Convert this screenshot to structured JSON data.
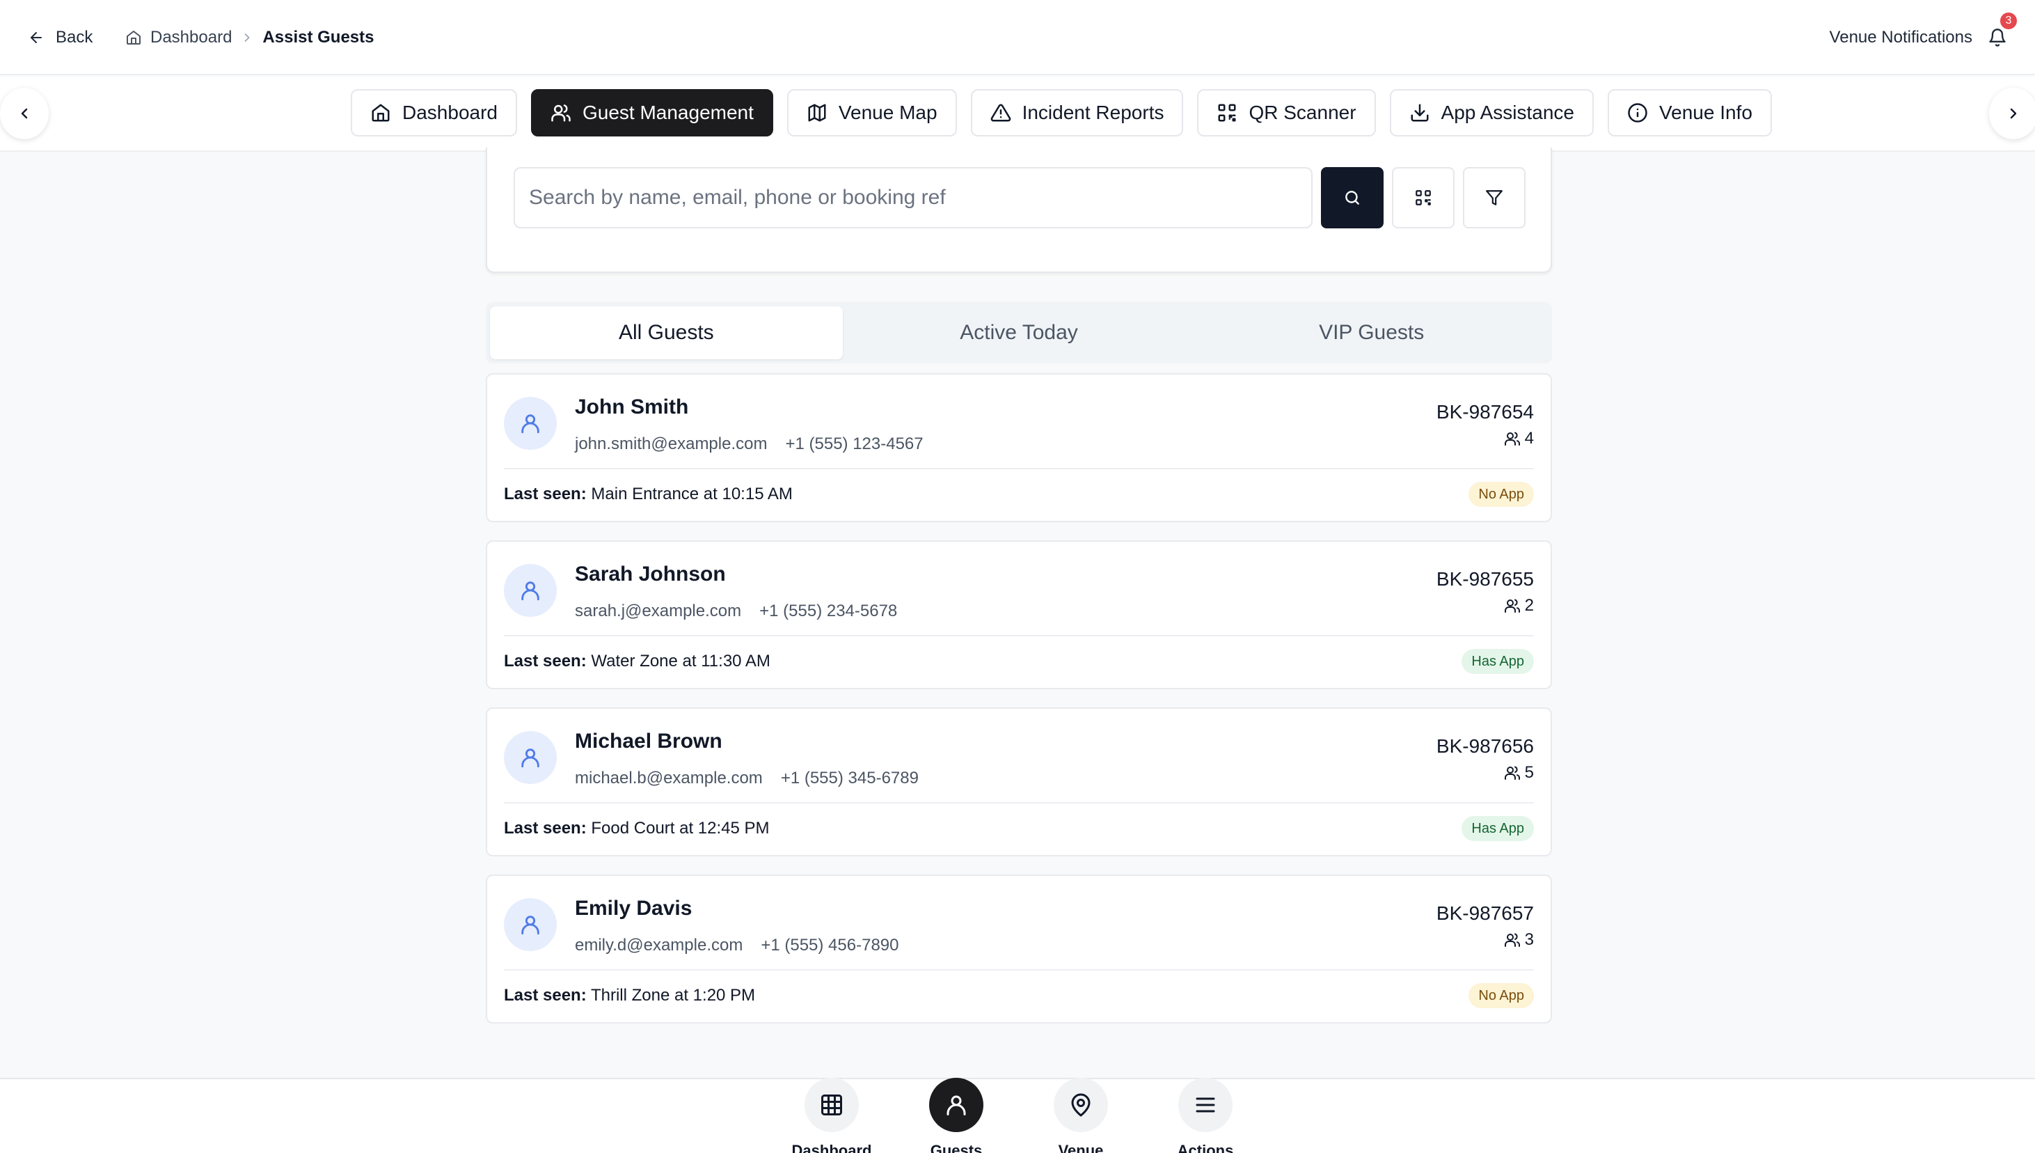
{
  "header": {
    "back_label": "Back",
    "breadcrumb": [
      {
        "label": "Dashboard",
        "icon": "home-icon"
      },
      {
        "label": "Assist Guests"
      }
    ],
    "notifications_label": "Venue Notifications",
    "notifications_count": "3"
  },
  "nav_tabs": [
    {
      "label": "Dashboard",
      "icon": "home-icon",
      "active": false
    },
    {
      "label": "Guest Management",
      "icon": "users-icon",
      "active": true
    },
    {
      "label": "Venue Map",
      "icon": "map-icon",
      "active": false
    },
    {
      "label": "Incident Reports",
      "icon": "alert-triangle-icon",
      "active": false
    },
    {
      "label": "QR Scanner",
      "icon": "qr-code-icon",
      "active": false
    },
    {
      "label": "App Assistance",
      "icon": "download-icon",
      "active": false
    },
    {
      "label": "Venue Info",
      "icon": "info-icon",
      "active": false
    }
  ],
  "search": {
    "placeholder": "Search by name, email, phone or booking ref",
    "value": ""
  },
  "guest_tabs": [
    "All Guests",
    "Active Today",
    "VIP Guests"
  ],
  "guest_tabs_active": "All Guests",
  "last_seen_label": "Last seen:",
  "guests": [
    {
      "name": "John Smith",
      "email": "john.smith@example.com",
      "phone": "+1 (555) 123-4567",
      "booking_ref": "BK-987654",
      "party_size": "4",
      "last_seen": "Main Entrance at 10:15 AM",
      "app_status": "No App"
    },
    {
      "name": "Sarah Johnson",
      "email": "sarah.j@example.com",
      "phone": "+1 (555) 234-5678",
      "booking_ref": "BK-987655",
      "party_size": "2",
      "last_seen": "Water Zone at 11:30 AM",
      "app_status": "Has App"
    },
    {
      "name": "Michael Brown",
      "email": "michael.b@example.com",
      "phone": "+1 (555) 345-6789",
      "booking_ref": "BK-987656",
      "party_size": "5",
      "last_seen": "Food Court at 12:45 PM",
      "app_status": "Has App"
    },
    {
      "name": "Emily Davis",
      "email": "emily.d@example.com",
      "phone": "+1 (555) 456-7890",
      "booking_ref": "BK-987657",
      "party_size": "3",
      "last_seen": "Thrill Zone at 1:20 PM",
      "app_status": "No App"
    }
  ],
  "bottom_nav": [
    {
      "label": "Dashboard",
      "icon": "grid-icon",
      "active": false
    },
    {
      "label": "Guests",
      "icon": "user-icon",
      "active": true
    },
    {
      "label": "Venue",
      "icon": "map-pin-icon",
      "active": false
    },
    {
      "label": "Actions",
      "icon": "menu-icon",
      "active": false
    }
  ],
  "colors": {
    "accent_dark": "#1c1c1e",
    "badge_red": "#e5484d",
    "no_app_bg": "#fdf3d5",
    "has_app_bg": "#e4f6e9",
    "avatar_bg": "#e6edfc"
  }
}
